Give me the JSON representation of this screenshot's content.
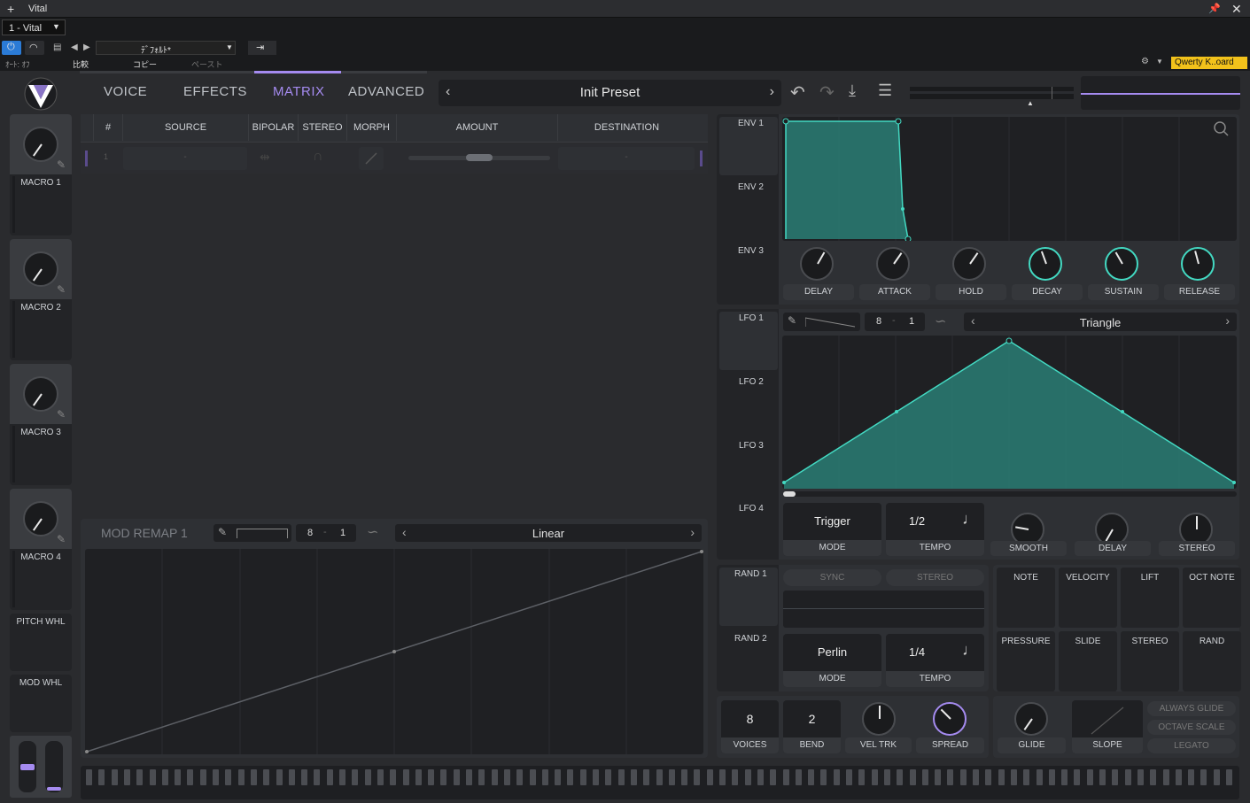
{
  "host": {
    "title": "Vital",
    "instance": "1 - Vital",
    "preset_slot": "ﾃﾞﾌｫﾙﾄ*",
    "auto_off": "ｵｰﾄ: ｵﾌ",
    "compare": "比較",
    "copy": "コピー",
    "paste": "ペースト",
    "keyboard": "Qwerty K..oard"
  },
  "tabs": [
    "VOICE",
    "EFFECTS",
    "MATRIX",
    "ADVANCED"
  ],
  "preset": {
    "name": "Init Preset"
  },
  "matrix": {
    "headers": [
      "#",
      "SOURCE",
      "BIPOLAR",
      "STEREO",
      "MORPH",
      "AMOUNT",
      "DESTINATION"
    ],
    "row": {
      "index": "1",
      "source": "-",
      "destination": "-"
    }
  },
  "macros": [
    "MACRO 1",
    "MACRO 2",
    "MACRO 3",
    "MACRO 4"
  ],
  "wheels": [
    "PITCH WHL",
    "MOD WHL"
  ],
  "remap": {
    "title": "MOD REMAP 1",
    "grid_a": "8",
    "grid_b": "1",
    "shape": "Linear"
  },
  "envs": [
    "ENV 1",
    "ENV 2",
    "ENV 3"
  ],
  "env_knobs": [
    "DELAY",
    "ATTACK",
    "HOLD",
    "DECAY",
    "SUSTAIN",
    "RELEASE"
  ],
  "lfos": [
    "LFO 1",
    "LFO 2",
    "LFO 3",
    "LFO 4"
  ],
  "lfo": {
    "grid_a": "8",
    "grid_b": "1",
    "shape": "Triangle",
    "mode": "Trigger",
    "mode_label": "MODE",
    "tempo": "1/2",
    "tempo_label": "TEMPO",
    "knobs": [
      "SMOOTH",
      "DELAY",
      "STEREO"
    ]
  },
  "rands": [
    "RAND 1",
    "RAND 2"
  ],
  "rand": {
    "sync": "SYNC",
    "stereo": "STEREO",
    "mode": "Perlin",
    "mode_label": "MODE",
    "tempo": "1/4",
    "tempo_label": "TEMPO"
  },
  "mods_row1": [
    "NOTE",
    "VELOCITY",
    "LIFT",
    "OCT NOTE"
  ],
  "mods_row2": [
    "PRESSURE",
    "SLIDE",
    "STEREO",
    "RAND"
  ],
  "voice": {
    "voices": "8",
    "voices_label": "VOICES",
    "bend": "2",
    "bend_label": "BEND",
    "veltrk": "VEL TRK",
    "spread": "SPREAD"
  },
  "glide": {
    "glide": "GLIDE",
    "slope": "SLOPE",
    "opts": [
      "ALWAYS GLIDE",
      "OCTAVE SCALE",
      "LEGATO"
    ]
  },
  "colors": {
    "accent": "#a58bf0",
    "teal": "#43d9c2"
  }
}
